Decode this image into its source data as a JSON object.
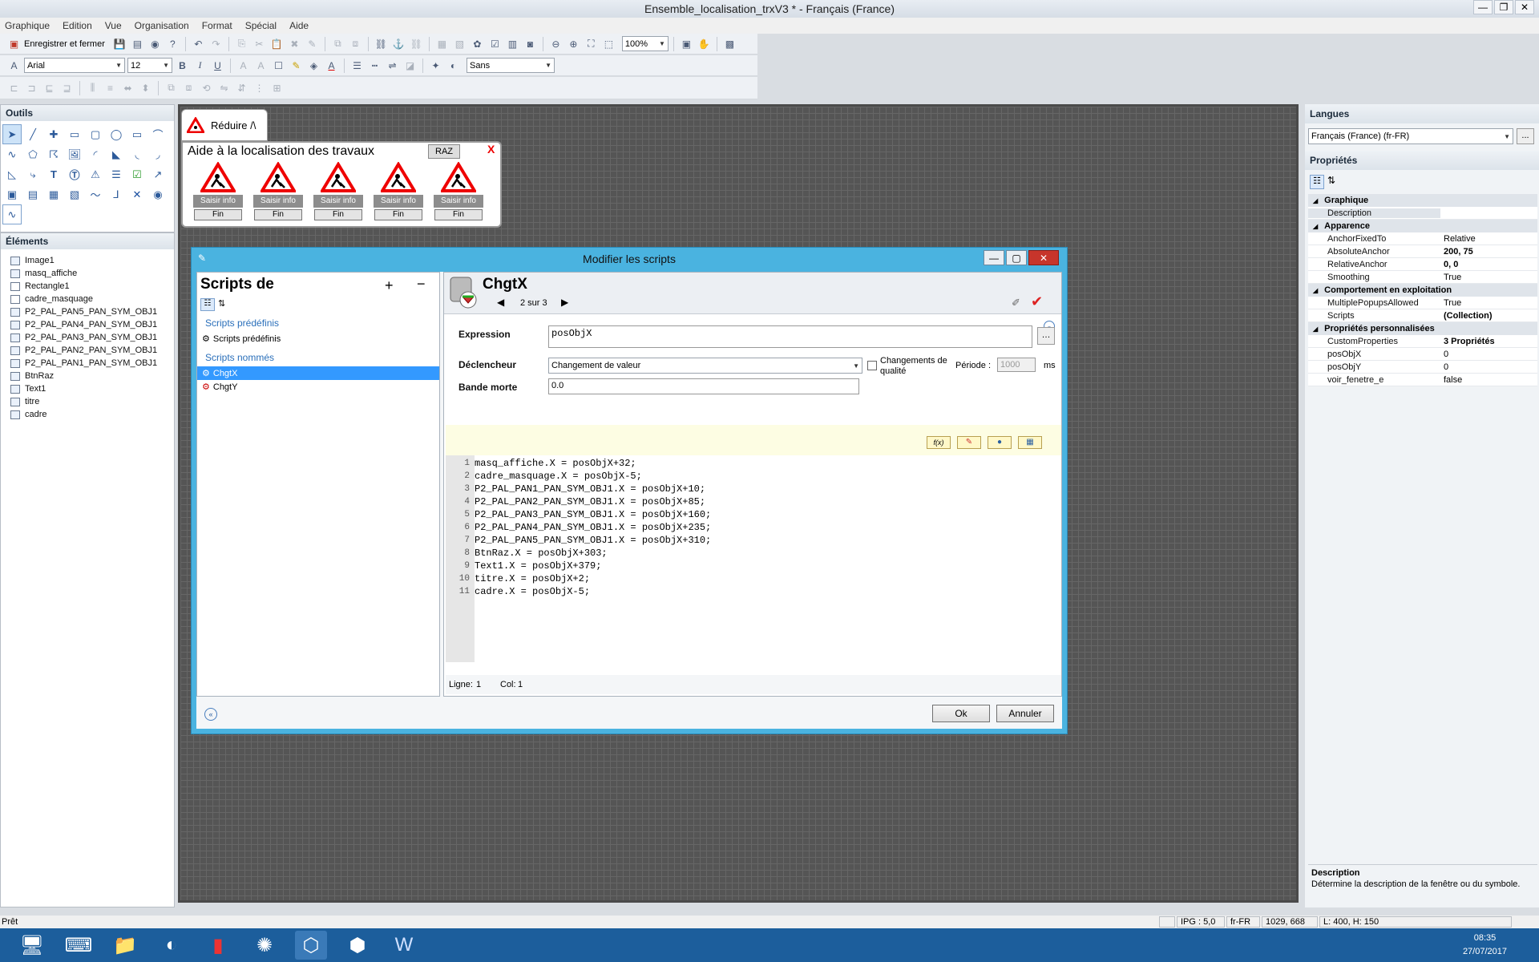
{
  "window": {
    "title": "Ensemble_localisation_trxV3 * - Français (France)"
  },
  "menu": [
    "Graphique",
    "Edition",
    "Vue",
    "Organisation",
    "Format",
    "Spécial",
    "Aide"
  ],
  "toolbar": {
    "save_close_label": "Enregistrer et fermer",
    "zoom": "100%",
    "font": "Arial",
    "font_size": "12",
    "bold": "B",
    "italic": "I",
    "underline": "U",
    "style_value": "Sans"
  },
  "outils": {
    "title": "Outils",
    "tools": [
      "pointer",
      "line",
      "cross",
      "rect",
      "rounded-rect",
      "ellipse",
      "rect2",
      "arc",
      "curve",
      "polygon",
      "polyline",
      "image",
      "arc2",
      "shape",
      "pie",
      "pie2",
      "chart",
      "bezier",
      "text",
      "text-frame",
      "alarm",
      "list",
      "checkbox",
      "link",
      "window",
      "window2",
      "window3",
      "link2",
      "trend",
      "connector",
      "x",
      "button",
      "trend-line"
    ]
  },
  "elements": {
    "title": "Éléments",
    "items": [
      "Image1",
      "masq_affiche",
      "Rectangle1",
      "cadre_masquage",
      "P2_PAL_PAN5_PAN_SYM_OBJ1",
      "P2_PAL_PAN4_PAN_SYM_OBJ1",
      "P2_PAL_PAN3_PAN_SYM_OBJ1",
      "P2_PAL_PAN2_PAN_SYM_OBJ1",
      "P2_PAL_PAN1_PAN_SYM_OBJ1",
      "BtnRaz",
      "Text1",
      "titre",
      "cadre"
    ]
  },
  "canvas": {
    "reduire_label": "Réduire /\\",
    "aide_title": "Aide à la localisation des travaux",
    "raz_label": "RAZ",
    "close_label": "X",
    "panels": [
      {
        "saisir": "Saisir info",
        "fin": "Fin"
      },
      {
        "saisir": "Saisir info",
        "fin": "Fin"
      },
      {
        "saisir": "Saisir info",
        "fin": "Fin"
      },
      {
        "saisir": "Saisir info",
        "fin": "Fin"
      },
      {
        "saisir": "Saisir info",
        "fin": "Fin"
      }
    ]
  },
  "dialog": {
    "title": "Modifier les scripts",
    "scripts_title": "Scripts de",
    "predefined_section": "Scripts prédéfinis",
    "predefined_item": "Scripts prédéfinis",
    "named_section": "Scripts nommés",
    "named_scripts": [
      "ChgtX",
      "ChgtY"
    ],
    "script_name": "ChgtX",
    "pager": "2 sur 3",
    "expression_label": "Expression",
    "expression_value": "posObjX",
    "declencheur_label": "Déclencheur",
    "declencheur_value": "Changement de valeur",
    "quality_label": "Changements de qualité",
    "periode_label": "Période :",
    "periode_value": "1000",
    "periode_unit": "ms",
    "bande_label": "Bande morte",
    "bande_value": "0.0",
    "code_lines": [
      "masq_affiche.X = posObjX+32;",
      "cadre_masquage.X = posObjX-5;",
      "P2_PAL_PAN1_PAN_SYM_OBJ1.X = posObjX+10;",
      "P2_PAL_PAN2_PAN_SYM_OBJ1.X = posObjX+85;",
      "P2_PAL_PAN3_PAN_SYM_OBJ1.X = posObjX+160;",
      "P2_PAL_PAN4_PAN_SYM_OBJ1.X = posObjX+235;",
      "P2_PAL_PAN5_PAN_SYM_OBJ1.X = posObjX+310;",
      "BtnRaz.X = posObjX+303;",
      "Text1.X = posObjX+379;",
      "titre.X = posObjX+2;",
      "cadre.X = posObjX-5;"
    ],
    "line_label": "Ligne:",
    "line_value": "1",
    "col_label": "Col:",
    "col_value": "1",
    "ok_label": "Ok",
    "cancel_label": "Annuler"
  },
  "right": {
    "langues_title": "Langues",
    "language": "Français (France) (fr-FR)",
    "more": "...",
    "props_title": "Propriétés",
    "categories": [
      {
        "name": "Graphique",
        "rows": [
          [
            "Description",
            ""
          ]
        ]
      },
      {
        "name": "Apparence",
        "rows": [
          [
            "AnchorFixedTo",
            "Relative"
          ],
          [
            "AbsoluteAnchor",
            "200, 75"
          ],
          [
            "RelativeAnchor",
            "0, 0"
          ],
          [
            "Smoothing",
            "True"
          ]
        ]
      },
      {
        "name": "Comportement en exploitation",
        "rows": [
          [
            "MultiplePopupsAllowed",
            "True"
          ],
          [
            "Scripts",
            "(Collection)"
          ]
        ]
      },
      {
        "name": "Propriétés personnalisées",
        "rows": [
          [
            "CustomProperties",
            "3 Propriétés"
          ],
          [
            "posObjX",
            "0"
          ],
          [
            "posObjY",
            "0"
          ],
          [
            "voir_fenetre_e",
            "false"
          ]
        ]
      }
    ],
    "desc_title": "Description",
    "desc_text": "Détermine la description de la fenêtre ou du symbole."
  },
  "status": {
    "text": "Prêt",
    "ipg": "IPG : 5,0",
    "lang": "fr-FR",
    "pos": "1029, 668",
    "size": "L: 400, H: 150"
  },
  "taskbar": {
    "time": "08:35",
    "date": "27/07/2017"
  },
  "colors": {
    "dialog_frame": "#4ab3e0",
    "selected": "#3399ff",
    "canvas": "#555555",
    "taskbar": "#1c5e9c"
  }
}
